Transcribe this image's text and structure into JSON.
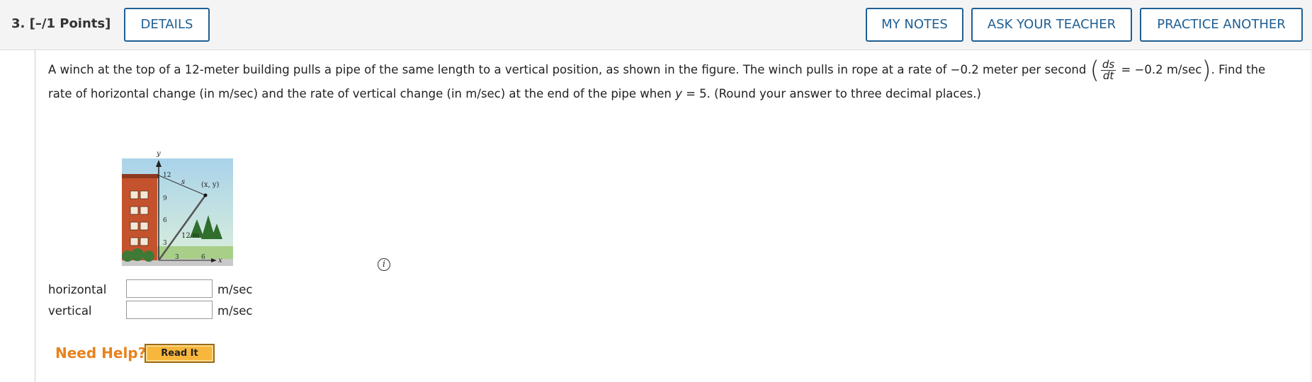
{
  "header": {
    "question_number": "3.",
    "points": "[–/1 Points]",
    "details_label": "DETAILS",
    "my_notes_label": "MY NOTES",
    "ask_teacher_label": "ASK YOUR TEACHER",
    "practice_another_label": "PRACTICE ANOTHER"
  },
  "problem": {
    "text_before": "A winch at the top of a 12-meter building pulls a pipe of the same length to a vertical position, as shown in the figure. The winch pulls in rope at a rate of −0.2 meter per second",
    "frac_num": "ds",
    "frac_den": "dt",
    "rate_text": "= −0.2 m/sec",
    "text_after_1": ". Find the rate of horizontal change (in m/sec) and the rate of vertical change (in m/sec) at the end of the pipe when",
    "var_y": "y",
    "text_after_2": "= 5. (Round your answer to three decimal places.)"
  },
  "figure": {
    "y_axis": "y",
    "x_axis": "x",
    "y_ticks": [
      "12",
      "9",
      "6",
      "3"
    ],
    "x_ticks": [
      "3",
      "6"
    ],
    "s_label": "s",
    "point_label": "(x, y)",
    "pipe_label": "12 m"
  },
  "answers": {
    "horizontal_label": "horizontal",
    "vertical_label": "vertical",
    "horizontal_value": "",
    "vertical_value": "",
    "unit": "m/sec"
  },
  "help": {
    "need_help_label": "Need Help?",
    "read_it_label": "Read It"
  },
  "colors": {
    "accent": "#1f5f93",
    "help_orange": "#e8821a",
    "button_gold": "#f6b73c",
    "building_brick": "#c4522c"
  }
}
